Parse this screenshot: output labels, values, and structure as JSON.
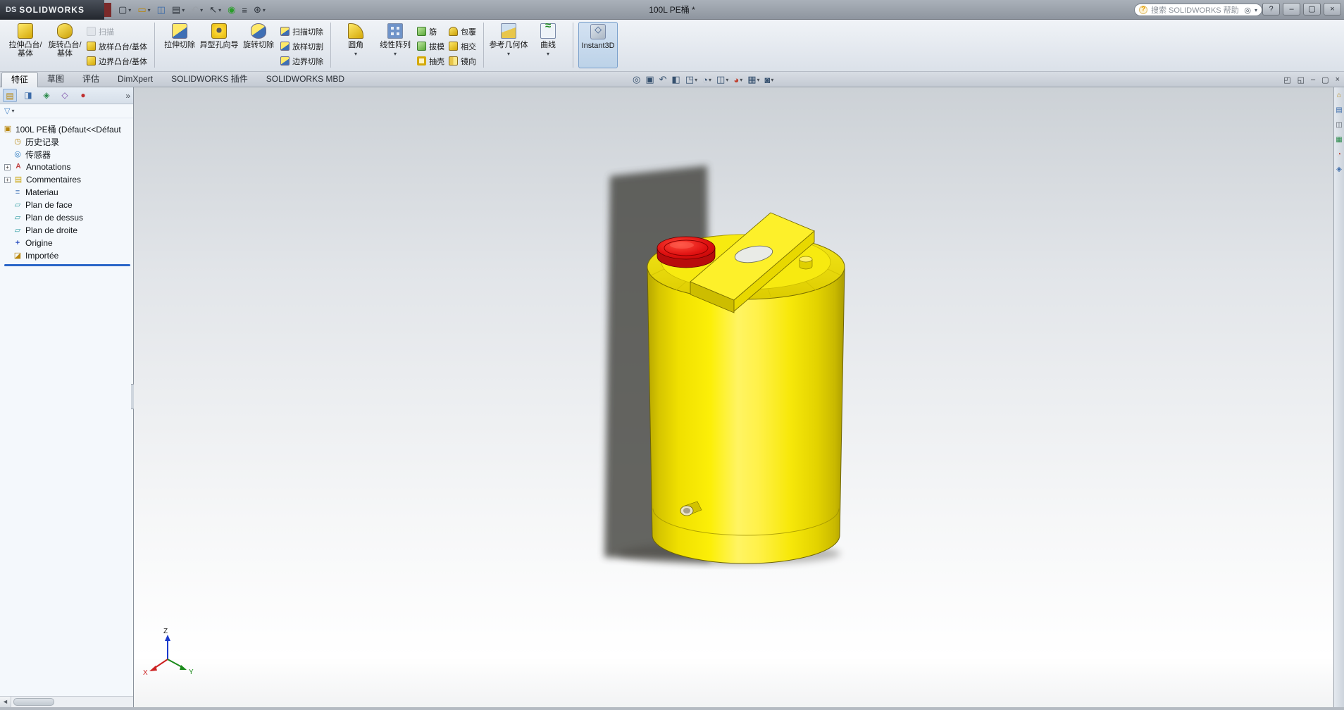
{
  "window": {
    "brand_mark": "DS",
    "brand_name": "SOLIDWORKS",
    "title": "100L PE桶 *",
    "help": "?",
    "minimize": "–",
    "maximize": "▢",
    "close": "×"
  },
  "search": {
    "placeholder": "搜索 SOLIDWORKS 帮助",
    "bubble": "?",
    "icon": "◎",
    "dropdown": "▾"
  },
  "quick_access": {
    "new": "▢",
    "open": "▭",
    "save": "◫",
    "print": "▤",
    "undo": "↶",
    "select": "↖",
    "rebuild": "◉",
    "props": "≡",
    "options": "⊛",
    "dd": "▾"
  },
  "ribbon": {
    "boss_extrude": "拉伸凸台/基体",
    "revolve_boss": "旋转凸台/基体",
    "sweep": "扫描",
    "loft_boss": "放样凸台/基体",
    "boundary_boss": "边界凸台/基体",
    "cut_extrude": "拉伸切除",
    "hole_wizard": "异型孔向导",
    "revolve_cut": "旋转切除",
    "sweep_cut": "扫描切除",
    "loft_cut": "放样切割",
    "boundary_cut": "边界切除",
    "fillet": "圆角",
    "linear_pattern": "线性阵列",
    "rib": "筋",
    "draft": "拔模",
    "shell": "抽壳",
    "wrap": "包覆",
    "intersect": "相交",
    "mirror": "镜向",
    "ref_geometry": "参考几何体",
    "curves": "曲线",
    "instant3d": "Instant3D",
    "dd": "▾"
  },
  "tabs": {
    "features": "特征",
    "sketch": "草图",
    "evaluate": "评估",
    "dimxpert": "DimXpert",
    "addins": "SOLIDWORKS 插件",
    "mbd": "SOLIDWORKS MBD"
  },
  "headsup": {
    "zoom_fit": "◎",
    "zoom_area": "▣",
    "prev_view": "↶",
    "section": "◧",
    "orientation": "◳",
    "display_style": "◔",
    "hide_show": "◫",
    "appearance": "◕",
    "scene": "▦",
    "settings": "◙",
    "dd": "▾"
  },
  "doc_controls": {
    "c1": "◰",
    "c2": "◱",
    "c3": "–",
    "c4": "▢",
    "c5": "×"
  },
  "panel": {
    "tabs": {
      "t1": "▤",
      "t2": "◨",
      "t3": "◈",
      "t4": "◇",
      "t5": "●"
    },
    "chevron": "»",
    "filter": "▽",
    "filter_dd": "▾"
  },
  "tree": {
    "root": "100L PE桶  (Défaut<<Défaut",
    "history": "历史记录",
    "sensors": "传感器",
    "annotations": "Annotations",
    "comments": "Commentaires",
    "material": "Materiau",
    "plan_face": "Plan de face",
    "plan_dessus": "Plan de dessus",
    "plan_droite": "Plan de droite",
    "origin": "Origine",
    "imported": "Importée",
    "expand": "+",
    "icons": {
      "part": "▣",
      "history": "◷",
      "sensors": "◎",
      "annotations": "A",
      "comments": "▤",
      "material": "≡",
      "plane": "▱",
      "origin": "+",
      "imported": "◪"
    }
  },
  "triad": {
    "x": "X",
    "y": "Y",
    "z": "Z"
  },
  "taskpane": {
    "i1": "⌂",
    "i2": "▤",
    "i3": "◫",
    "i4": "▦",
    "i5": "◔",
    "i6": "◈"
  },
  "scrollbar": {
    "left_arrow": "◄"
  },
  "colors": {
    "tank_yellow": "#f3e600",
    "tank_shade": "#b7a700",
    "cap_red": "#d61a1a",
    "shadow_gray": "#4a4a46",
    "rollback_blue": "#2a66c8",
    "viewport_top": "#ccd1d6",
    "viewport_bottom": "#ffffff"
  },
  "model": {
    "name": "100L PE桶"
  }
}
